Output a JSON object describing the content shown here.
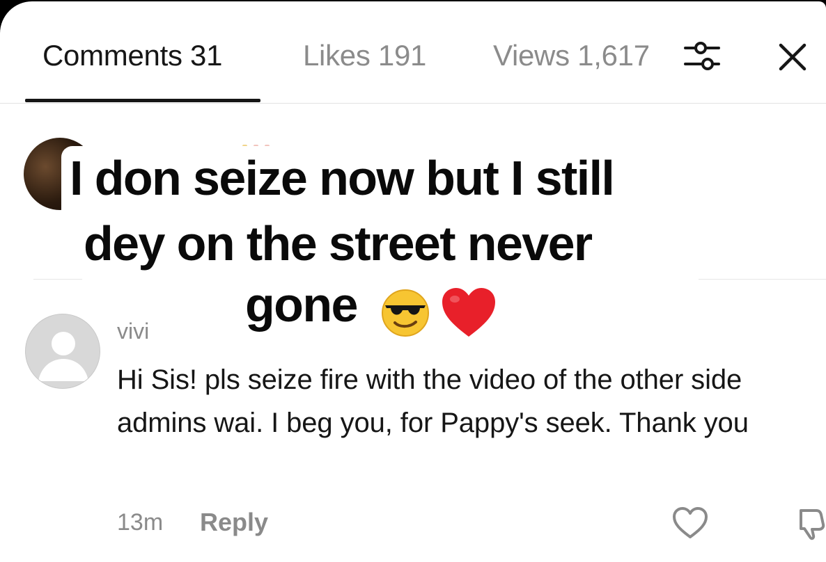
{
  "tabs": {
    "comments": "Comments 31",
    "likes": "Likes 191",
    "views": "Views 1,617"
  },
  "icons": {
    "filter": "sliders-icon",
    "close": "close-icon",
    "like": "heart-outline-icon",
    "dislike": "thumbs-down-icon"
  },
  "overlay_caption": {
    "line1": "I don seize now but I still",
    "line2": "dey on the street never",
    "line3": "gone",
    "emoji": [
      "sunglasses-smiley-emoji",
      "red-heart-emoji"
    ]
  },
  "comment": {
    "username": "vivi",
    "text": "Hi Sis! pls seize fire with the video of the other side admins wai. I beg you, for Pappy's seek. Thank you",
    "time": "13m",
    "reply_label": "Reply"
  },
  "colors": {
    "active_text": "#161616",
    "muted_text": "#8a8a8a",
    "background": "#ffffff",
    "heart_red": "#e8202a"
  }
}
